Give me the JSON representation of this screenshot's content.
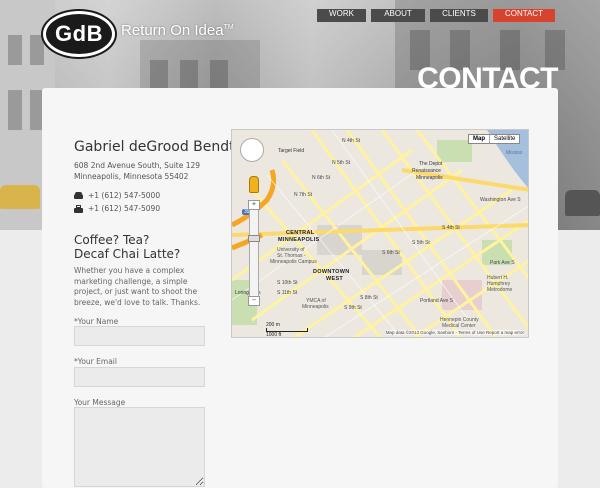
{
  "brand": {
    "logo_text": "GdB",
    "tagline": "Return On Idea",
    "trademark": "TM"
  },
  "nav": {
    "work": "WORK",
    "about": "ABOUT",
    "clients": "CLIENTS",
    "contact": "CONTACT",
    "active": "CONTACT",
    "active_color": "#d8432f"
  },
  "page": {
    "title": "CONTACT"
  },
  "contact": {
    "company": "Gabriel deGrood Bendt",
    "address_line1": "608 2nd Avenue South, Suite 129",
    "address_line2": "Minneapolis, Minnesota  55402",
    "phone": "+1 (612) 547-5000",
    "fax": "+1 (612) 547-5090"
  },
  "form": {
    "heading_line1": "Coffee? Tea?",
    "heading_line2": "Decaf Chai Latte?",
    "intro": "Whether you have a complex marketing challenge, a simple project, or just want to shoot the breeze, we'd love to talk.  Thanks.",
    "name_label": "*Your Name",
    "email_label": "*Your Email",
    "message_label": "Your Message"
  },
  "map": {
    "type_map": "Map",
    "type_satellite": "Satellite",
    "scale_metric": "200 m",
    "scale_imperial": "1000 ft",
    "attribution": "Map data ©2013 Google, Sanborn - Terms of Use   Report a map error",
    "labels": {
      "target_field": "Target Field",
      "n_4th": "N 4th St",
      "n_5th": "N 5th St",
      "n_6th": "N 6th St",
      "n_7th": "N 7th St",
      "depot": "The Depot",
      "renaissance": "Renaissance",
      "minneapolis": "Minneapolis",
      "washington": "Washington Ave S",
      "mississippi": "Mississ",
      "central": "CENTRAL",
      "minneapolis_caps": "MINNEAPOLIS",
      "ust_1": "University of",
      "ust_2": "St. Thomas -",
      "ust_3": "Minneapolis Campus",
      "downtown": "DOWNTOWN",
      "west": "WEST",
      "ymca_1": "YMCA of",
      "ymca_2": "Minneapolis",
      "hospital_1": "Hubert H.",
      "hospital_2": "Humphrey",
      "hospital_3": "Metrodome",
      "hcmc_1": "Hennepin County",
      "hcmc_2": "Medical Center",
      "s_4th": "S 4th St",
      "s_5th": "S 5th St",
      "s_6th": "S 6th St",
      "s_8th": "S 8th St",
      "s_9th": "S 9th St",
      "s_10th": "S 10th St",
      "s_11th": "S 11th St",
      "park": "Park Ave S",
      "portland": "Portland Ave S",
      "i394": "394",
      "loring": "Loring Park"
    }
  }
}
